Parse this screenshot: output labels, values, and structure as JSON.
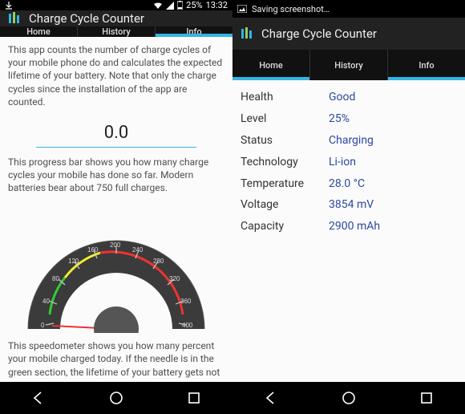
{
  "statusbar_left": {
    "battery_pct": "25%",
    "time": "13:32",
    "saving_text": "Saving screenshot…"
  },
  "app": {
    "title": "Charge Cycle Counter",
    "tabs": {
      "home": "Home",
      "history": "History",
      "info": "Info"
    }
  },
  "info_screen": {
    "para1": "This app counts the number of charge cycles of your mobile phone do and calculates the expected lifetime of your battery. Note that only the charge cycles since the installation of the app are counted.",
    "cycle_count": "0.0",
    "para2": "This progress bar shows you how many charge cycles your mobile has done so far. Modern batteries bear about 750 full charges.",
    "para3": "This speedometer shows you how many percent your mobile charged today. If the needle is in the green section, the lifetime of your battery gets not"
  },
  "home_screen": {
    "health": {
      "label": "Health",
      "value": "Good"
    },
    "level": {
      "label": "Level",
      "value": "25%"
    },
    "status": {
      "label": "Status",
      "value": "Charging"
    },
    "tech": {
      "label": "Technology",
      "value": "Li-ion"
    },
    "temp": {
      "label": "Temperature",
      "value": "28.0 °C"
    },
    "voltage": {
      "label": "Voltage",
      "value": "3854 mV"
    },
    "capacity": {
      "label": "Capacity",
      "value": "2900 mAh"
    }
  },
  "chart_data": {
    "type": "gauge",
    "title": "Daily charge percent speedometer",
    "min": 0,
    "max": 400,
    "ticks": [
      0,
      40,
      80,
      120,
      160,
      200,
      240,
      280,
      320,
      360,
      400
    ],
    "green_start": 0,
    "green_end": 100,
    "yellow_start": 100,
    "yellow_end": 170,
    "red_start": 170,
    "red_end": 400,
    "needle_value": 5
  }
}
